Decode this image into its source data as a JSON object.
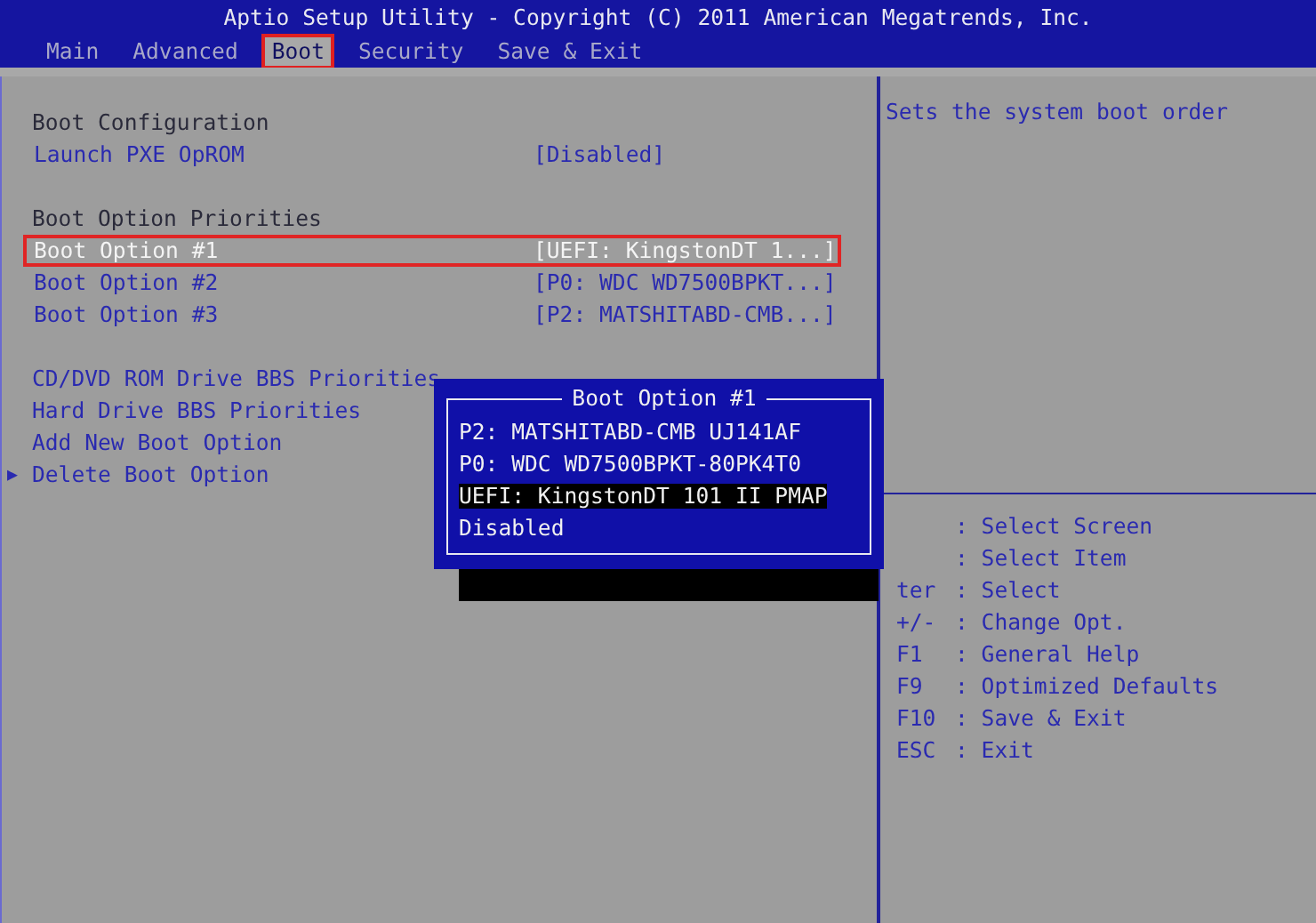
{
  "title": "Aptio Setup Utility - Copyright (C) 2011 American Megatrends, Inc.",
  "tabs": [
    {
      "label": "Main",
      "selected": false
    },
    {
      "label": "Advanced",
      "selected": false
    },
    {
      "label": "Boot",
      "selected": true
    },
    {
      "label": "Security",
      "selected": false
    },
    {
      "label": "Save & Exit",
      "selected": false
    }
  ],
  "settings": [
    {
      "kind": "heading",
      "label": "Boot Configuration"
    },
    {
      "kind": "option",
      "label": "Launch PXE OpROM",
      "value": "[Disabled]",
      "selected": false
    },
    {
      "kind": "spacer"
    },
    {
      "kind": "heading",
      "label": "Boot Option Priorities"
    },
    {
      "kind": "option",
      "label": "Boot Option #1",
      "value": "[UEFI: KingstonDT 1...]",
      "selected": true
    },
    {
      "kind": "option",
      "label": "Boot Option #2",
      "value": "[P0: WDC WD7500BPKT...]",
      "selected": false
    },
    {
      "kind": "option",
      "label": "Boot Option #3",
      "value": "[P2: MATSHITABD-CMB...]",
      "selected": false
    },
    {
      "kind": "spacer"
    },
    {
      "kind": "link",
      "label": "CD/DVD ROM Drive BBS Priorities"
    },
    {
      "kind": "link",
      "label": "Hard Drive BBS Priorities"
    },
    {
      "kind": "link",
      "label": "Add New Boot Option"
    },
    {
      "kind": "submenu",
      "marker": "▶",
      "label": "Delete Boot Option"
    }
  ],
  "help": {
    "description": "Sets the system boot order",
    "keys": [
      {
        "text": ": Select Screen"
      },
      {
        "text": ": Select Item"
      },
      {
        "key": "ter",
        "text": ": Select"
      },
      {
        "key": "+/-",
        "text": ": Change Opt."
      },
      {
        "key": "F1",
        "text": ": General Help"
      },
      {
        "key": "F9",
        "text": ": Optimized Defaults"
      },
      {
        "key": "F10",
        "text": ": Save & Exit"
      },
      {
        "key": "ESC",
        "text": ": Exit"
      }
    ]
  },
  "popup": {
    "title": "Boot Option #1",
    "options": [
      {
        "label": "P2: MATSHITABD-CMB UJ141AF",
        "selected": false
      },
      {
        "label": "P0: WDC WD7500BPKT-80PK4T0",
        "selected": false
      },
      {
        "label": "UEFI: KingstonDT 101 II PMAP",
        "selected": true
      },
      {
        "label": "Disabled",
        "selected": false
      }
    ]
  }
}
